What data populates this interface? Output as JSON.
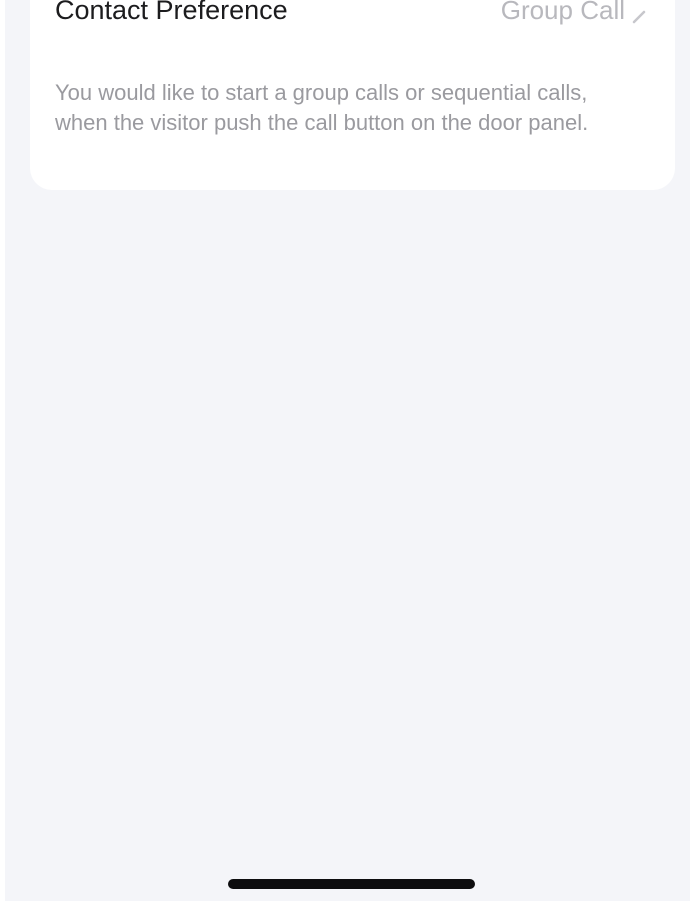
{
  "contact_preference": {
    "label": "Contact Preference",
    "value": "Group Call",
    "description": "You would like to start a group calls or sequential calls, when the visitor push the call button on the door panel."
  },
  "icons": {
    "chevron": "chevron-right-icon"
  },
  "colors": {
    "background": "#f4f5f9",
    "card": "#ffffff",
    "label_text": "#1c1c1e",
    "value_text": "#b8b8bd",
    "description_text": "#9a9a9f",
    "home_indicator": "#0d0d0f"
  }
}
